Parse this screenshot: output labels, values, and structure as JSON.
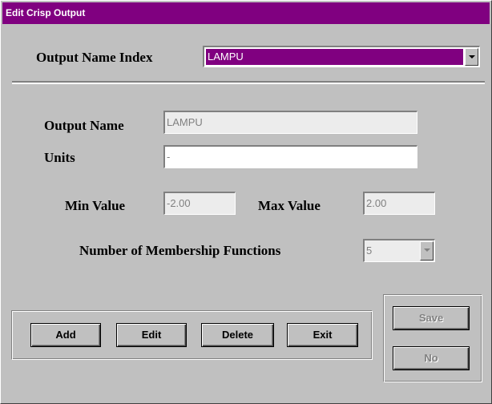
{
  "window": {
    "title": "Edit Crisp Output"
  },
  "output_index": {
    "label": "Output Name Index",
    "value": "LAMPU"
  },
  "output_name": {
    "label": "Output Name",
    "value": "LAMPU"
  },
  "units": {
    "label": "Units",
    "value": "-"
  },
  "min_value": {
    "label": "Min Value",
    "value": "-2.00"
  },
  "max_value": {
    "label": "Max Value",
    "value": "2.00"
  },
  "membership": {
    "label": "Number of  Membership Functions",
    "value": "5"
  },
  "buttons": {
    "add": "Add",
    "edit": "Edit",
    "delete": "Delete",
    "exit": "Exit",
    "save": "Save",
    "no": "No"
  },
  "colors": {
    "title_bar": "#800080",
    "window_bg": "#c0c0c0"
  }
}
